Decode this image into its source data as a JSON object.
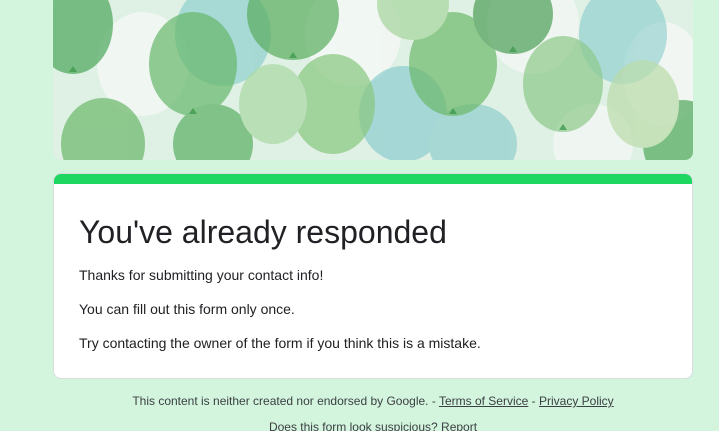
{
  "response": {
    "title": "You've already responded",
    "lines": [
      "Thanks for submitting your contact info!",
      "You can fill out this form only once.",
      "Try contacting the owner of the form if you think this is a mistake."
    ]
  },
  "footer": {
    "disclaimer": "This content is neither created nor endorsed by Google. -",
    "terms_label": "Terms of Service",
    "separator": "-",
    "privacy_label": "Privacy Policy",
    "suspicious_text": "Does this form look suspicious?",
    "report_label": "Report"
  },
  "colors": {
    "background": "#d3f5de",
    "accent": "#1ed760",
    "text": "#202124"
  },
  "icons": {
    "banner": "balloons-banner-image"
  }
}
